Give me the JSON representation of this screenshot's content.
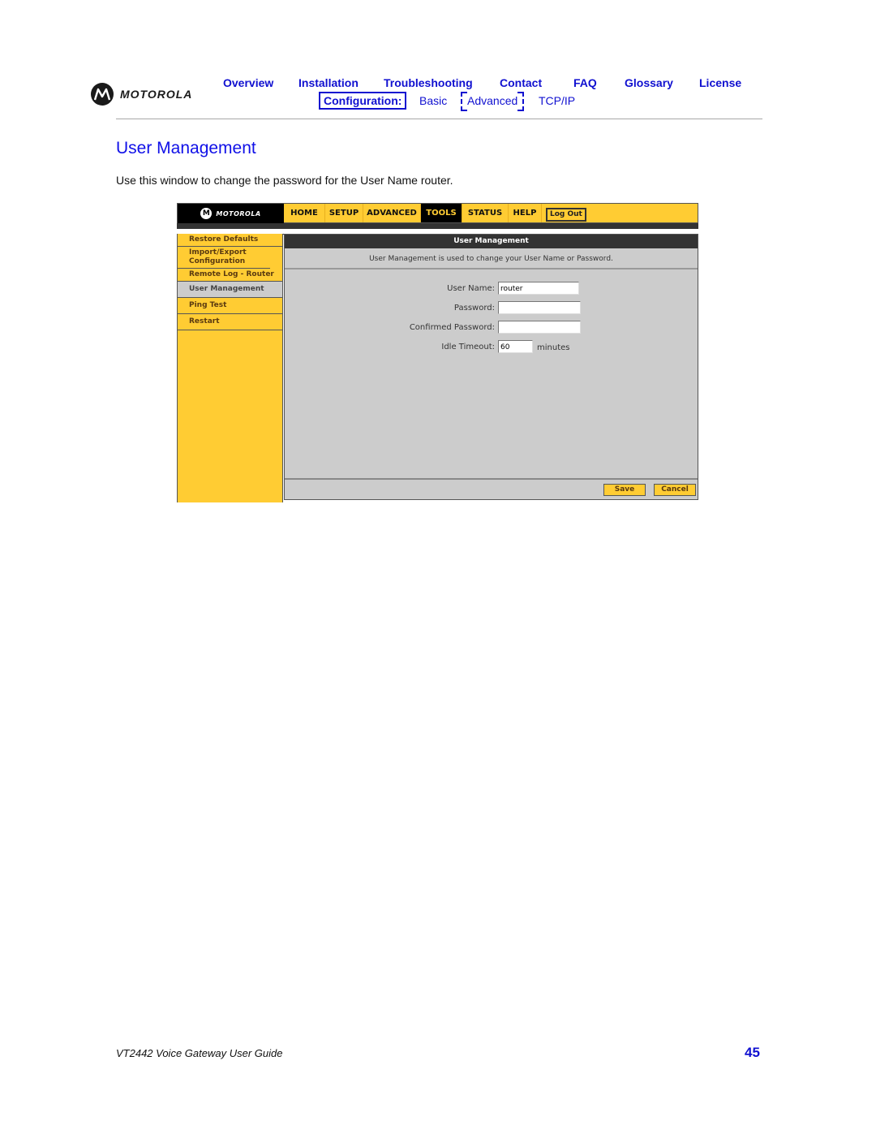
{
  "brand": {
    "name": "MOTOROLA",
    "logo_icon": "motorola-batwing-logo"
  },
  "topnav": {
    "items": [
      "Overview",
      "Installation",
      "Troubleshooting",
      "Contact",
      "FAQ",
      "Glossary",
      "License"
    ]
  },
  "subnav": {
    "label": "Configuration:",
    "items": [
      "Basic",
      "Advanced",
      "TCP/IP"
    ],
    "current": "Advanced"
  },
  "page": {
    "title": "User Management",
    "intro": "Use this window to change the password for the User Name router."
  },
  "screenshot": {
    "brand": "MOTOROLA",
    "tabs": [
      "HOME",
      "SETUP",
      "ADVANCED",
      "TOOLS",
      "STATUS",
      "HELP"
    ],
    "active_tab": "TOOLS",
    "logout_label": "Log Out",
    "sidebar": [
      "Restore Defaults",
      "Import/Export Configuration",
      "Remote Log - Router",
      "User Management",
      "Ping Test",
      "Restart"
    ],
    "active_sidebar": "User Management",
    "section_title": "User Management",
    "section_desc": "User Management is used to change your User Name or Password.",
    "form": {
      "user_name_label": "User Name:",
      "user_name_value": "router",
      "password_label": "Password:",
      "password_value": "",
      "confirm_label": "Confirmed Password:",
      "confirm_value": "",
      "idle_label": "Idle Timeout:",
      "idle_value": "60",
      "idle_unit": "minutes"
    },
    "save_label": "Save",
    "cancel_label": "Cancel"
  },
  "footer": {
    "guide_title": "VT2442 Voice Gateway User Guide",
    "page_number": "45"
  }
}
